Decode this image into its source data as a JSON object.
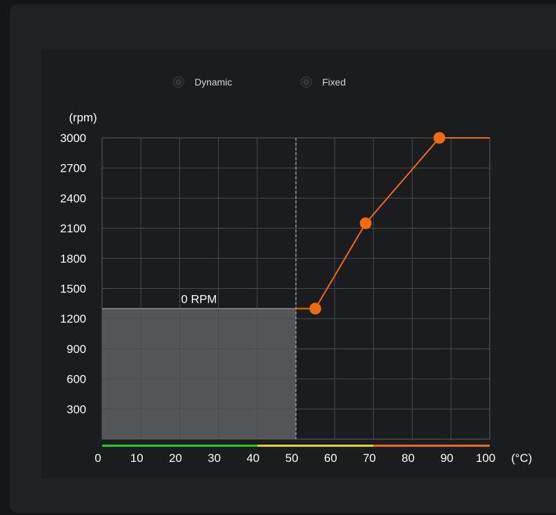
{
  "mode_options": [
    {
      "label": "Dynamic",
      "selected": false
    },
    {
      "label": "Fixed",
      "selected": false
    }
  ],
  "chart_data": {
    "type": "line",
    "xlabel": "(°C)",
    "ylabel": "(rpm)",
    "xlim": [
      0,
      100
    ],
    "ylim": [
      0,
      3000
    ],
    "x_ticks": [
      0,
      10,
      20,
      30,
      40,
      50,
      60,
      70,
      80,
      90,
      100
    ],
    "y_ticks": [
      300,
      600,
      900,
      1200,
      1500,
      1800,
      2100,
      2400,
      2700,
      3000
    ],
    "grid": true,
    "series": [
      {
        "curve": [
          [
            50,
            1300
          ],
          [
            55,
            1300
          ],
          [
            68,
            2150
          ],
          [
            87,
            3000
          ],
          [
            100,
            3000
          ]
        ],
        "control_points": [
          [
            55,
            1300
          ],
          [
            68,
            2150
          ],
          [
            87,
            3000
          ]
        ],
        "color": "#f26b0f"
      }
    ],
    "zero_rpm_zone": {
      "label": "0 RPM",
      "x_range": [
        0,
        50
      ],
      "rpm": 1300,
      "color": "#555658"
    },
    "threshold_line_x": 50,
    "temperature_bands": [
      {
        "from": 0,
        "to": 40,
        "color": "#1fd11f"
      },
      {
        "from": 40,
        "to": 70,
        "color": "#e8dc0c"
      },
      {
        "from": 70,
        "to": 100,
        "color": "#f26b0f"
      }
    ]
  }
}
